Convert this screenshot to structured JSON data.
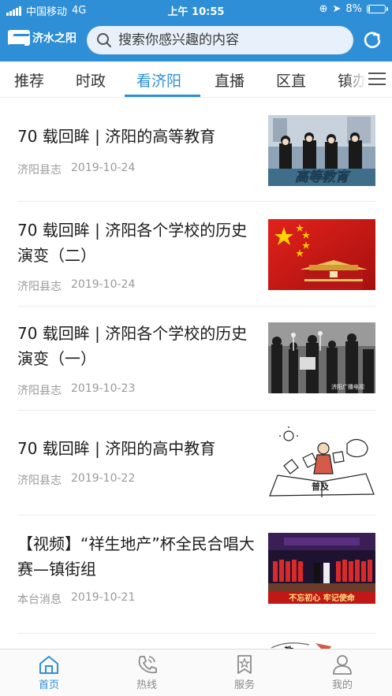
{
  "status_bar": {
    "carrier": "中国移动",
    "network": "4G",
    "time": "上午 10:55",
    "battery": "8%",
    "battery_level": 0.08
  },
  "header": {
    "logo_text": "济水之阳",
    "search_placeholder": "搜索你感兴趣的内容",
    "accent_color": "#2f8fd6"
  },
  "tabs": [
    {
      "label": "推荐"
    },
    {
      "label": "时政"
    },
    {
      "label": "看济阳"
    },
    {
      "label": "直播"
    },
    {
      "label": "区直"
    },
    {
      "label": "镇办"
    }
  ],
  "active_tab": "看济阳",
  "news": [
    {
      "title": "70 载回眸 | 济阳的高等教育",
      "source": "济阳县志",
      "date": "2019-10-24",
      "thumb_caption": "高等教育"
    },
    {
      "title": "70 载回眸 | 济阳各个学校的历史演变（二）",
      "source": "济阳县志",
      "date": "2019-10-24"
    },
    {
      "title": "70 载回眸 | 济阳各个学校的历史演变（一）",
      "source": "济阳县志",
      "date": "2019-10-23",
      "thumb_caption": "济阳广播电视"
    },
    {
      "title": "70 载回眸 | 济阳的高中教育",
      "source": "济阳县志",
      "date": "2019-10-22",
      "thumb_caption": "普及"
    },
    {
      "title": "【视频】“祥生地产”杯全民合唱大赛—镇街组",
      "source": "本台消息",
      "date": "2019-10-21",
      "thumb_caption": "不忘初心 牢记使命"
    }
  ],
  "partial_thumb_caption": "教",
  "bottom_nav": [
    {
      "label": "首页",
      "icon": "home-icon"
    },
    {
      "label": "热线",
      "icon": "phone-icon"
    },
    {
      "label": "服务",
      "icon": "bookmark-star-icon"
    },
    {
      "label": "我的",
      "icon": "user-icon"
    }
  ]
}
